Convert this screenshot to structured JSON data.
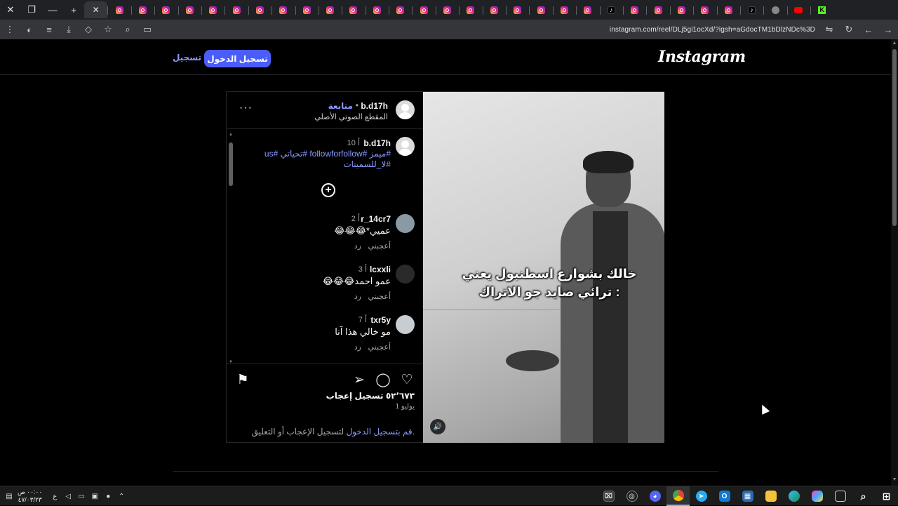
{
  "browser": {
    "url": "instagram.com/reel/DLj5gi1ocXd/?igsh=aGdocTM1bDlzNDc%3D",
    "new_tab_symbol": "+",
    "close_symbol": "✕"
  },
  "header": {
    "logo": "Instagram",
    "login_label": "تسجيل الدخول",
    "signup_label": "تسجيل"
  },
  "post": {
    "username": "b.d17h",
    "follow_label": "متابعة",
    "dot": "•",
    "audio_label": "المقطع الصوتي الأصلي",
    "more_symbol": "···",
    "caption_user": "b.d17h",
    "caption_time": "10 أ",
    "caption_tags": "#ميمز #followforfollow #تحياتي #us #لا_للسمينات",
    "overlay_line1": "خالك بشوارع اسطنبول يعني",
    "overlay_line2": "ترائي صايد جو الاتراك :",
    "comments": [
      {
        "user": "r_14cr7",
        "time": "2 أ",
        "text": "عميي*😂😂😂",
        "like": "أعجبني",
        "reply": "رد"
      },
      {
        "user": "lcxxli",
        "time": "3 أ",
        "text": "عمو احمد😂😂😂",
        "like": "أعجبني",
        "reply": "رد"
      },
      {
        "user": "txr5y",
        "time": "7 أ",
        "text": "مو خالي هذا آنا",
        "like": "أعجبني",
        "reply": "رد"
      }
    ],
    "likes": "٥٢٬٦٧٣ تسجيل إعجاب",
    "date": "1 يوليو",
    "login_prompt_link": "قم بتسجيل الدخول",
    "login_prompt_rest": " لتسجيل الإعجاب أو التعليق."
  },
  "taskbar": {
    "time": "٠٠:٠٠ ص",
    "date": "٤٧/٠٣/٢٣",
    "lang": "ع"
  },
  "icons": {
    "heart": "heart-icon",
    "comment": "comment-icon",
    "share": "share-icon",
    "save": "bookmark-icon",
    "mute": "speaker-icon"
  }
}
